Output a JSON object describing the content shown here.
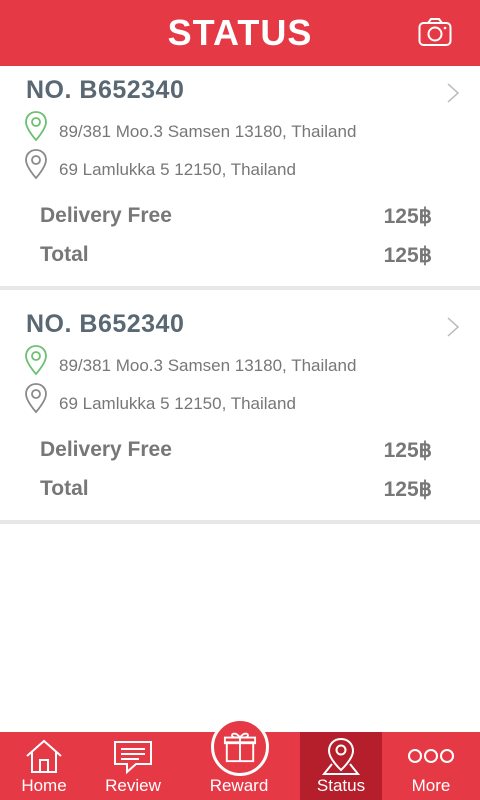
{
  "header": {
    "title": "STATUS",
    "camera_icon": "camera-icon"
  },
  "orders": [
    {
      "number": "NO. B652340",
      "from_address": "89/381 Moo.3 Samsen 13180, Thailand",
      "to_address": "69 Lamlukka 5 12150, Thailand",
      "delivery_label": "Delivery Free",
      "delivery_value": "125฿",
      "total_label": "Total",
      "total_value": "125฿"
    },
    {
      "number": "NO. B652340",
      "from_address": "89/381 Moo.3 Samsen 13180, Thailand",
      "to_address": "69 Lamlukka 5 12150, Thailand",
      "delivery_label": "Delivery Free",
      "delivery_value": "125฿",
      "total_label": "Total",
      "total_value": "125฿"
    }
  ],
  "tabs": [
    {
      "label": "Home",
      "icon": "home-icon"
    },
    {
      "label": "Review",
      "icon": "chat-icon"
    },
    {
      "label": "Reward",
      "icon": "gift-icon"
    },
    {
      "label": "Status",
      "icon": "map-pin-icon",
      "active": true
    },
    {
      "label": "More",
      "icon": "more-icon"
    }
  ],
  "colors": {
    "brand": "#e53946",
    "active_tab": "#b51e2b",
    "pin_green": "#6cc070"
  }
}
